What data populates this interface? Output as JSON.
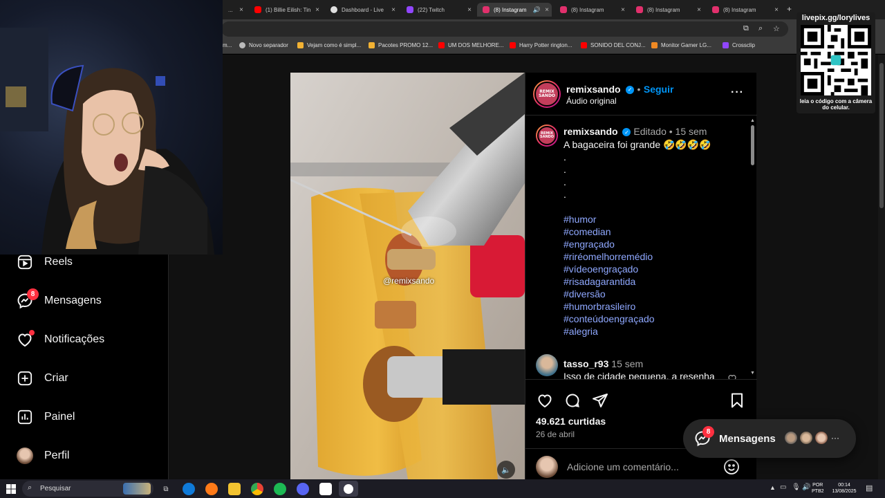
{
  "browser": {
    "tabs": [
      {
        "label": "...",
        "color": "#666666",
        "close": "×"
      },
      {
        "label": "(1) Billie Eilish: Tin",
        "color": "#ff0000",
        "close": "×"
      },
      {
        "label": "Dashboard - Live",
        "color": "#e0e0e0",
        "close": "×"
      },
      {
        "label": "(22) Twitch",
        "color": "#9146ff",
        "close": "×"
      },
      {
        "label": "(8) Instagram",
        "color": "#e1306c",
        "close": "×",
        "active": true
      },
      {
        "label": "(8) Instagram",
        "color": "#e1306c",
        "close": "×"
      },
      {
        "label": "(8) Instagram",
        "color": "#e1306c",
        "close": "×"
      },
      {
        "label": "(8) Instagram",
        "color": "#e1306c",
        "close": "×"
      }
    ],
    "newtab": "+",
    "mute_icon": "speaker-icon",
    "bookmarks": [
      {
        "label": "Novo separador",
        "color": "#bbbbbb"
      },
      {
        "label": "Vejam como é simpl...",
        "color": "#f2b233"
      },
      {
        "label": "Pacotes PROMO 12...",
        "color": "#f2b233"
      },
      {
        "label": "UM DOS MELHORE...",
        "color": "#ff0000"
      },
      {
        "label": "Harry Potter rington...",
        "color": "#ff0000"
      },
      {
        "label": "SONIDO DEL CONJ...",
        "color": "#ff0000"
      },
      {
        "label": "Monitor Gamer LG...",
        "color": "#f08a24"
      },
      {
        "label": "Crossclip",
        "color": "#9146ff"
      }
    ],
    "first_bookmark_fragment": "m..."
  },
  "sidebar": {
    "items": [
      {
        "label": "Reels",
        "icon": "reels-icon"
      },
      {
        "label": "Mensagens",
        "icon": "messenger-icon",
        "badge": "8"
      },
      {
        "label": "Notificações",
        "icon": "heart-icon",
        "dot": true
      },
      {
        "label": "Criar",
        "icon": "plus-square-icon"
      },
      {
        "label": "Painel",
        "icon": "dashboard-icon"
      },
      {
        "label": "Perfil",
        "icon": "avatar"
      }
    ]
  },
  "post": {
    "author": "remixsando",
    "avatar_text": "REMIX SANDO",
    "follow": "Seguir",
    "separator": "•",
    "audio": "Áudio original",
    "more": "···",
    "watermark": "@remixsando",
    "caption": {
      "author": "remixsando",
      "edited": "Editado",
      "time": "15 sem",
      "text": "A bagaceira foi grande 🤣🤣🤣🤣",
      "dots": [
        ".",
        ".",
        ".",
        "."
      ],
      "hashtags": [
        "#humor",
        "#comedian",
        "#engraçado",
        "#riréomelhorremédio",
        "#vídeoengraçado",
        "#risadagarantida",
        "#diversão",
        "#humorbrasileiro",
        "#conteúdoengraçado",
        "#alegria"
      ]
    },
    "comment": {
      "author": "tasso_r93",
      "time": "15 sem",
      "text": "Isso de cidade pequena, a resenha"
    },
    "likes": "49.621 curtidas",
    "date": "26 de abril",
    "comment_placeholder": "Adicione um comentário..."
  },
  "messages_float": {
    "label": "Mensagens",
    "badge": "8",
    "more": "···"
  },
  "qr": {
    "title": "livepix.gg/lorylives",
    "caption": "leia o código com a câmera do celular."
  },
  "taskbar": {
    "search_placeholder": "Pesquisar",
    "lang_top": "POR",
    "lang_bottom": "PTB2",
    "time": "00:14",
    "date": "13/08/2025"
  }
}
